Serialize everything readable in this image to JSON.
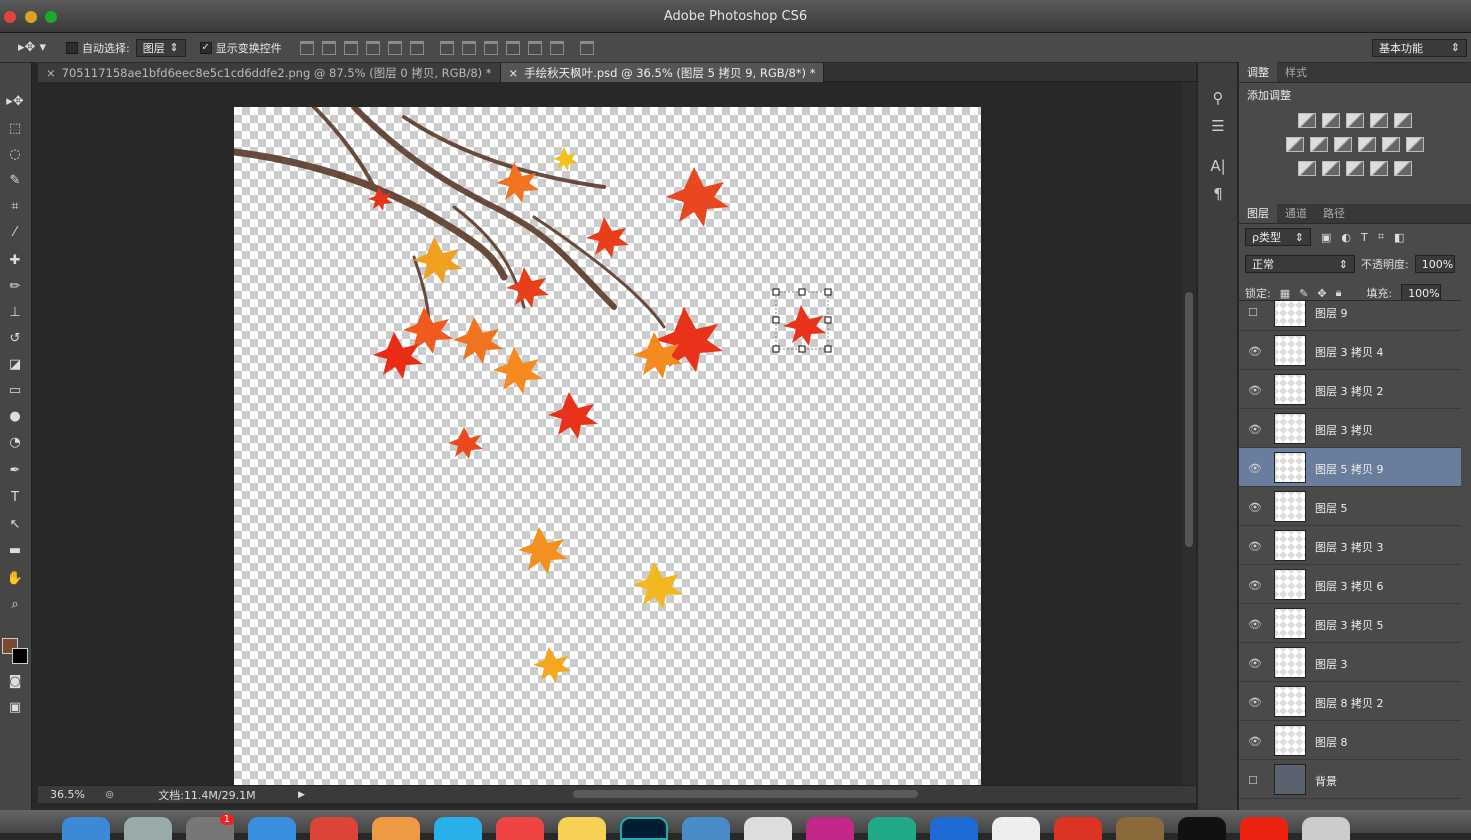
{
  "app": {
    "title": "Adobe Photoshop CS6"
  },
  "options": {
    "auto_select_label": "自动选择:",
    "auto_select_target": "图层",
    "show_transform_label": "显示变换控件",
    "show_transform_checked": true,
    "workspace": "基本功能"
  },
  "tabs": [
    {
      "title": "705117158ae1bfd6eec8e5c1cd6ddfe2.png @ 87.5% (图层 0 拷贝, RGB/8) *",
      "active": false
    },
    {
      "title": "手绘秋天枫叶.psd @ 36.5% (图层 5 拷贝 9, RGB/8*) *",
      "active": true
    }
  ],
  "status": {
    "zoom": "36.5%",
    "doc": "文档:11.4M/29.1M"
  },
  "adjustments": {
    "tab_adjust": "调整",
    "tab_style": "样式",
    "heading": "添加调整"
  },
  "layers_panel": {
    "tab_layers": "图层",
    "tab_channels": "通道",
    "tab_paths": "路径",
    "filter_kind": "ρ类型",
    "blend_mode": "正常",
    "opacity_label": "不透明度:",
    "opacity": "100%",
    "lock_label": "锁定:",
    "fill_label": "填充:",
    "fill": "100%",
    "layers": [
      {
        "name": "图层 9",
        "visible": false,
        "selected": false
      },
      {
        "name": "图层 3 拷贝 4",
        "visible": true,
        "selected": false
      },
      {
        "name": "图层 3 拷贝 2",
        "visible": true,
        "selected": false
      },
      {
        "name": "图层 3 拷贝",
        "visible": true,
        "selected": false
      },
      {
        "name": "图层 5 拷贝 9",
        "visible": true,
        "selected": true
      },
      {
        "name": "图层 5",
        "visible": true,
        "selected": false
      },
      {
        "name": "图层 3 拷贝 3",
        "visible": true,
        "selected": false
      },
      {
        "name": "图层 3 拷贝 6",
        "visible": true,
        "selected": false
      },
      {
        "name": "图层 3 拷贝 5",
        "visible": true,
        "selected": false
      },
      {
        "name": "图层 3",
        "visible": true,
        "selected": false
      },
      {
        "name": "图层 8 拷贝 2",
        "visible": true,
        "selected": false
      },
      {
        "name": "图层 8",
        "visible": true,
        "selected": false
      },
      {
        "name": "背景",
        "visible": false,
        "selected": false
      }
    ]
  },
  "colors": {
    "accent_selection": "#6a7d9d",
    "foreground": "#7a4a2e",
    "background": "#000000"
  },
  "dock": {
    "notification_badge": "1"
  }
}
